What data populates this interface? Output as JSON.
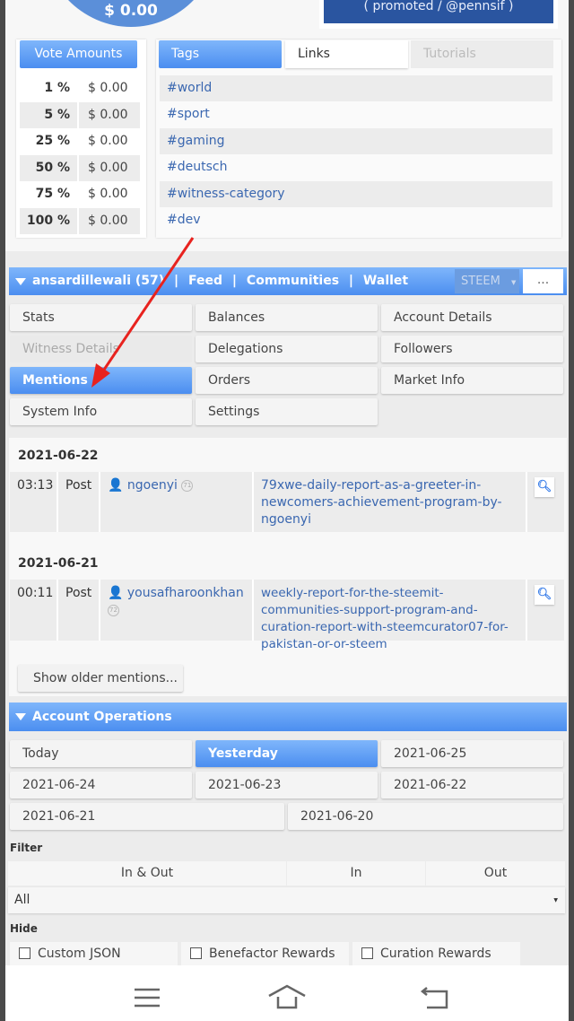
{
  "top": {
    "circle_amount": "$ 0.00",
    "promo_text": "( promoted / @pennsif )"
  },
  "vote_amounts": {
    "title": "Vote Amounts",
    "rows": [
      {
        "pct": "1 %",
        "value": "$ 0.00"
      },
      {
        "pct": "5 %",
        "value": "$ 0.00"
      },
      {
        "pct": "25 %",
        "value": "$ 0.00"
      },
      {
        "pct": "50 %",
        "value": "$ 0.00"
      },
      {
        "pct": "75 %",
        "value": "$ 0.00"
      },
      {
        "pct": "100 %",
        "value": "$ 0.00"
      }
    ]
  },
  "tabs": {
    "items": [
      "Tags",
      "Links",
      "Tutorials"
    ],
    "active": "Tags"
  },
  "tags": [
    "#world",
    "#sport",
    "#gaming",
    "#deutsch",
    "#witness-category",
    "#dev"
  ],
  "account_bar": {
    "user": "ansardillewali (57)",
    "sep": "|",
    "links": [
      "Feed",
      "Communities",
      "Wallet"
    ],
    "currency": "STEEM",
    "more": "..."
  },
  "menu": [
    "Stats",
    "Balances",
    "Account Details",
    "Witness Details",
    "Delegations",
    "Followers",
    "Mentions",
    "Orders",
    "Market Info",
    "System Info",
    "Settings"
  ],
  "menu_active": "Mentions",
  "mentions": [
    {
      "date": "2021-06-22",
      "time": "03:13",
      "type": "Post",
      "user": "ngoenyi",
      "rep": "71",
      "permlink": "79xwe-daily-report-as-a-greeter-in-newcomers-achievement-program-by-ngoenyi"
    },
    {
      "date": "2021-06-21",
      "time": "00:11",
      "type": "Post",
      "user": "yousafharoonkhan",
      "rep": "72",
      "permlink": "weekly-report-for-the-steemit-communities-support-program-and-curation-report-with-steemcurator07-for-pakistan-or-or-steem"
    }
  ],
  "show_older": "Show older mentions...",
  "account_operations": {
    "title": "Account Operations",
    "dates": [
      "Today",
      "Yesterday",
      "2021-06-25",
      "2021-06-24",
      "2021-06-23",
      "2021-06-22",
      "2021-06-21",
      "2021-06-20"
    ],
    "active": "Yesterday",
    "filter_label": "Filter",
    "filter_tabs": [
      "In & Out",
      "In",
      "Out"
    ],
    "filter_active": "In & Out",
    "select_value": "All",
    "hide_label": "Hide",
    "hide_options": [
      "Custom JSON",
      "Benefactor Rewards",
      "Curation Rewards"
    ]
  },
  "colors": {
    "accent": "#4b8ef0",
    "link": "#3a67b0",
    "annotation_arrow": "#e8231f"
  }
}
